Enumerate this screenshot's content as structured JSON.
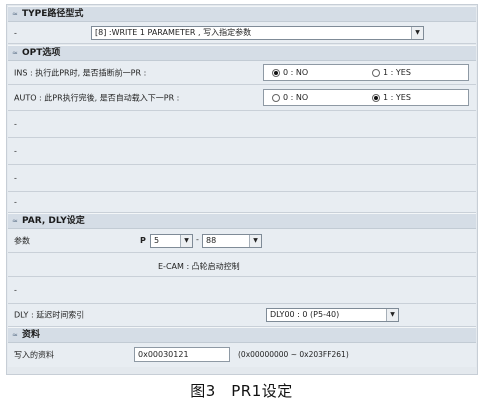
{
  "sections": {
    "type": {
      "title": "TYPE路径型式",
      "collapse": "≈"
    },
    "opt": {
      "title": "OPT选项",
      "collapse": "≈"
    },
    "par": {
      "title": "PAR, DLY设定",
      "collapse": "≈"
    },
    "data": {
      "title": "资料",
      "collapse": "≈"
    }
  },
  "type_row": {
    "dash": "-",
    "select_value": "[8] :WRITE 1 PARAMETER , 写入指定参数"
  },
  "ins": {
    "label": "INS : 执行此PR时, 是否插断前一PR :",
    "opt0": "0 : NO",
    "opt1": "1 : YES",
    "selected": "0"
  },
  "auto": {
    "label": "AUTO : 此PR执行完後, 是否自动载入下一PR :",
    "opt0": "0 : NO",
    "opt1": "1 : YES",
    "selected": "1"
  },
  "blank_rows": [
    "-",
    "-",
    "-",
    "-"
  ],
  "param": {
    "label": "参数",
    "p_label": "P",
    "p_value": "5",
    "sep": "-",
    "value2": "88"
  },
  "ecam": {
    "text": "E-CAM : 凸轮启动控制"
  },
  "par_blank": "-",
  "dly": {
    "label": "DLY : 延迟时间索引",
    "select_value": "DLY00 : 0 (P5-40)"
  },
  "write": {
    "label": "写入的资料",
    "value": "0x00030121",
    "range": "(0x00000000 ~ 0x203FF261)"
  },
  "caption": "图3　PR1设定",
  "dropdown_arrow": "▼"
}
